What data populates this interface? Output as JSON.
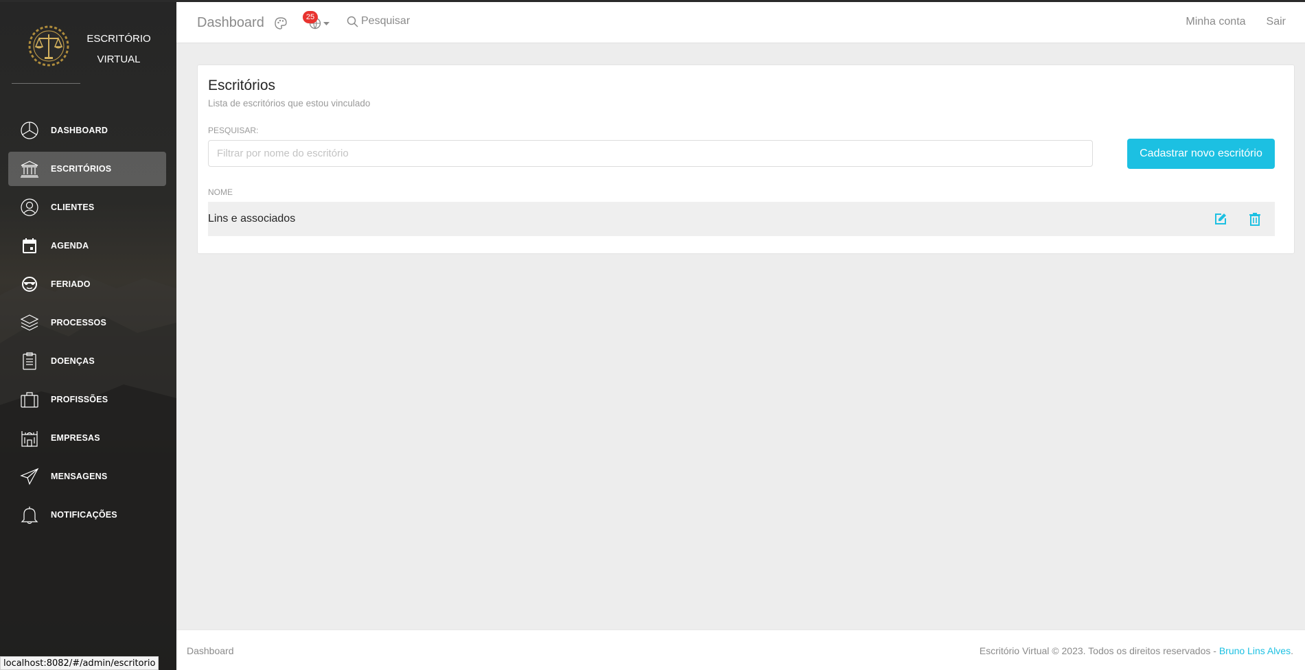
{
  "brand": {
    "line1": "ESCRITÓRIO",
    "line2": "VIRTUAL"
  },
  "sidebar": {
    "items": [
      {
        "label": "DASHBOARD",
        "icon": "pie-chart-icon"
      },
      {
        "label": "ESCRITÓRIOS",
        "icon": "bank-icon",
        "active": true
      },
      {
        "label": "CLIENTES",
        "icon": "user-circle-icon"
      },
      {
        "label": "AGENDA",
        "icon": "calendar-icon"
      },
      {
        "label": "FERIADO",
        "icon": "sunglasses-icon"
      },
      {
        "label": "PROCESSOS",
        "icon": "layers-icon"
      },
      {
        "label": "DOENÇAS",
        "icon": "clipboard-icon"
      },
      {
        "label": "PROFISSÕES",
        "icon": "briefcase-icon"
      },
      {
        "label": "EMPRESAS",
        "icon": "building-icon"
      },
      {
        "label": "MENSAGENS",
        "icon": "paper-plane-icon"
      },
      {
        "label": "NOTIFICAÇÕES",
        "icon": "bell-icon"
      }
    ]
  },
  "topbar": {
    "title": "Dashboard",
    "notification_count": "25",
    "search_label": "Pesquisar",
    "account_label": "Minha conta",
    "logout_label": "Sair"
  },
  "card": {
    "title": "Escritórios",
    "subtitle": "Lista de escritórios que estou vinculado",
    "search_label": "PESQUISAR:",
    "filter_placeholder": "Filtrar por nome do escritório",
    "add_button": "Cadastrar novo escritório",
    "column_header": "NOME",
    "rows": [
      {
        "name": "Lins e associados"
      }
    ]
  },
  "footer": {
    "left": "Dashboard",
    "copyright": "Escritório Virtual © 2023. Todos os direitos reservados - ",
    "author": "Bruno Lins Alves",
    "period": "."
  },
  "statusbar": {
    "url": "localhost:8082/#/admin/escritorio"
  },
  "colors": {
    "accent": "#1cc0e2",
    "badge": "#e8332f",
    "sidebar_active": "#6b6b6b"
  }
}
